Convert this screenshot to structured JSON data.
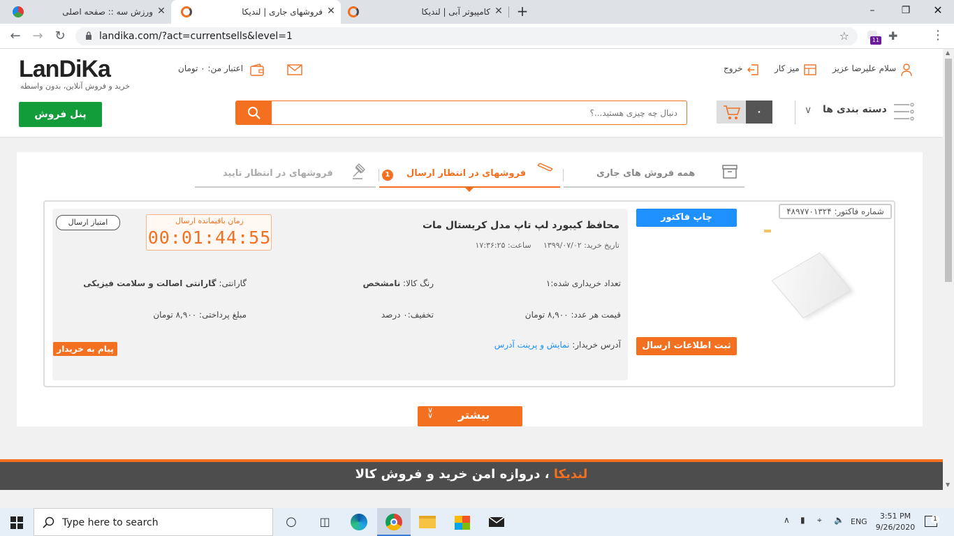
{
  "browser": {
    "tabs": [
      {
        "title": "ورزش سه :: صفحه اصلی",
        "active": false
      },
      {
        "title": "فروشهای جاری | لندیکا",
        "active": true
      },
      {
        "title": "کامپیوتر آبی | لندیکا",
        "active": false
      }
    ],
    "url": "landika.com/?act=currentsells&level=1",
    "extension_badge": "11"
  },
  "header": {
    "logo_text": "LanDiKa",
    "tagline": "خرید و فروش آنلاین، بدون واسطه",
    "credit_label": "اعتبار من: ۰ تومان",
    "greeting": "سلام علیرضا عزیز",
    "dashboard_label": "میز کار",
    "logout_label": "خروج",
    "categories_label": "دسته بندی ها",
    "cart_count": "۰",
    "search_placeholder": "دنبال چه چیزی هستید...؟",
    "sell_panel_label": "پنل فروش"
  },
  "tabs": {
    "all_current": "همه فروش های جاری",
    "awaiting_shipment": "فروشهای در انتظار ارسال",
    "awaiting_shipment_badge": "1",
    "awaiting_approval": "فروشهای در انتظار تایید"
  },
  "order": {
    "invoice_number": "شماره فاکتور: ۴۸۹۷۷۰۱۳۲۴",
    "print_invoice": "چاپ فاکتور",
    "register_shipping": "ثبت اطلاعات ارسال",
    "product_title": "محافظ کیبورد لپ تاپ مدل کریستال مات",
    "purchase_date_label": "تاریخ خرید:",
    "purchase_date": "۱۳۹۹/۰۷/۰۲",
    "time_label": "ساعت:",
    "time": "۱۷:۳۶:۲۵",
    "timer_label": "زمان باقیمانده ارسال",
    "timer_value": "00:01:44:55",
    "shipping_score": "امتیاز ارسال",
    "qty_label": "تعداد خریداری شده:",
    "qty": "۱",
    "color_label": "رنگ کالا:",
    "color": "نامشخص",
    "warranty_label": "گارانتی:",
    "warranty": "گارانتی اصالت و سلامت فیزیکی",
    "unit_price_label": "قیمت هر عدد:",
    "unit_price": "۸,۹۰۰ تومان",
    "discount_label": "تخفیف:",
    "discount": "۰ درصد",
    "payment_label": "مبلغ پرداختی:",
    "payment": "۸,۹۰۰ تومان",
    "address_label": "آدرس خریدار:",
    "address_link": "نمایش و پرینت آدرس",
    "message_buyer": "پیام به خریدار"
  },
  "more_label": "بیشتر",
  "footer": {
    "brand": "لندیکا",
    "slogan": "، دروازه امن خرید و فروش کالا"
  },
  "taskbar": {
    "search_placeholder": "Type here to search",
    "lang": "ENG",
    "time": "3:51 PM",
    "date": "9/26/2020",
    "notif_count": "1"
  },
  "colors": {
    "brand_orange": "#f37021",
    "blue_button": "#1e90ff",
    "green_button": "#129c3a"
  }
}
